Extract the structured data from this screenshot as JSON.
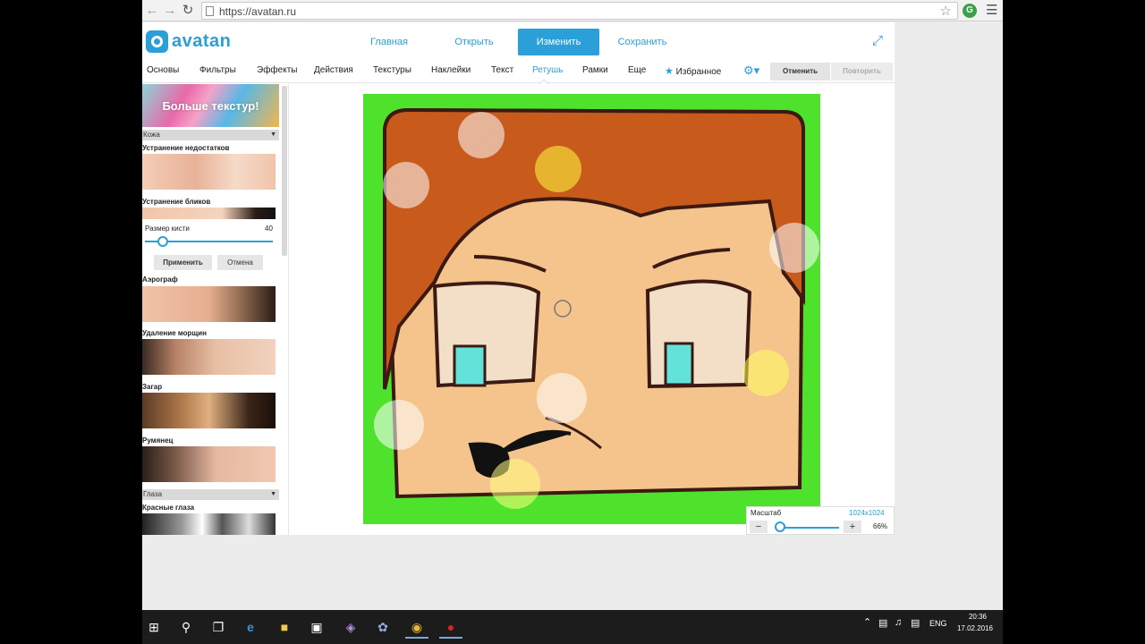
{
  "browser": {
    "url": "https://avatan.ru",
    "icons": [
      "back-icon",
      "forward-icon",
      "reload-icon",
      "bookmark-star-icon",
      "extension-icon",
      "chrome-menu-icon"
    ]
  },
  "header": {
    "logo_text": "avatan",
    "nav": [
      "Главная",
      "Открыть",
      "Изменить",
      "Сохранить"
    ],
    "active_nav": "Изменить",
    "accent_color": "#2a9fd8"
  },
  "toolbar": {
    "tools": [
      "Основы",
      "Фильтры",
      "Эффекты",
      "Действия",
      "Текстуры",
      "Наклейки",
      "Текст",
      "Ретушь",
      "Рамки",
      "Еще"
    ],
    "active_tool": "Ретушь",
    "favorites": "Избранное",
    "undo": "Отменить",
    "redo": "Повторить"
  },
  "sidebar": {
    "banner": "Больше текстур!",
    "cat_skin": "Кожа",
    "item1": "Устранение недостатков",
    "item2": "Устранение бликов",
    "brush_label": "Размер кисти",
    "brush_value": "40",
    "brush_level": 0.14,
    "apply": "Применить",
    "cancel": "Отмена",
    "item3": "Аэрограф",
    "item4": "Удаление морщин",
    "item5": "Загар",
    "item6": "Румянец",
    "cat_eyes": "Глаза",
    "item7": "Красные глаза"
  },
  "zoom": {
    "label": "Масштаб",
    "resolution": "1024x1024",
    "percent": "66%",
    "minus": "−",
    "plus": "+",
    "level": 0.05
  },
  "taskbar": {
    "lang": "ENG",
    "time": "20:36",
    "date": "17.02.2016"
  }
}
